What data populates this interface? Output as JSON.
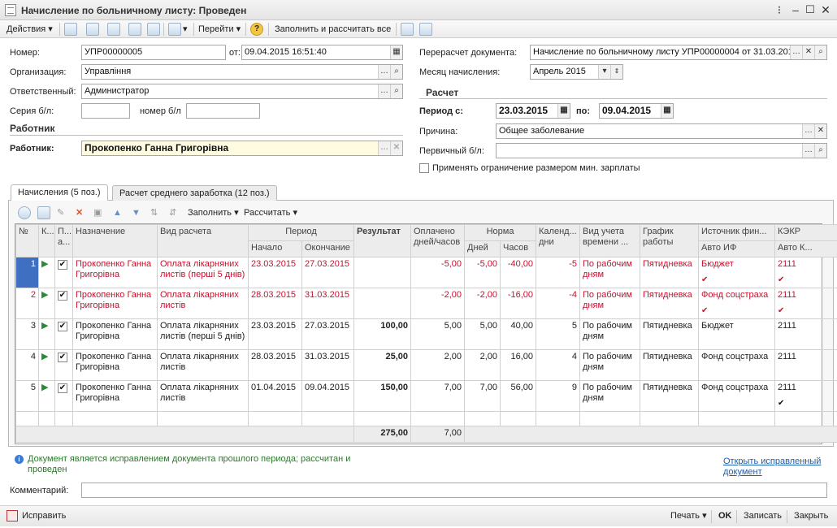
{
  "window": {
    "title": "Начисление по больничному листу: Проведен"
  },
  "toolbar": {
    "actions": "Действия",
    "goto": "Перейти",
    "fill_calc": "Заполнить и рассчитать все"
  },
  "form": {
    "number_label": "Номер:",
    "number": "УПР00000005",
    "date_label": "от:",
    "date": "09.04.2015 16:51:40",
    "org_label": "Организация:",
    "org": "Управління",
    "resp_label": "Ответственный:",
    "resp": "Администратор",
    "series_label": "Серия б/л:",
    "series": "",
    "num_bl_label": "номер б/л",
    "num_bl": "",
    "worker_section": "Работник",
    "worker_label": "Работник:",
    "worker": "Прокопенко Ганна Григорівна",
    "recalc_label": "Перерасчет документа:",
    "recalc": "Начисление по больничному листу УПР00000004 от 31.03.201",
    "month_label": "Месяц начисления:",
    "month": "Апрель 2015",
    "calc_section": "Расчет",
    "period_label": "Период с:",
    "period_from": "23.03.2015",
    "period_to_label": "по:",
    "period_to": "09.04.2015",
    "reason_label": "Причина:",
    "reason": "Общее заболевание",
    "primary_label": "Первичный б/л:",
    "primary": "",
    "minsalary_label": "Применять ограничение размером мин. зарплаты"
  },
  "tabs": [
    {
      "label": "Начисления (5 поз.)"
    },
    {
      "label": "Расчет среднего заработка (12 поз.)"
    }
  ],
  "grid_toolbar": {
    "fill": "Заполнить",
    "calc": "Рассчитать"
  },
  "grid": {
    "headers": {
      "n": "№",
      "k": "К...",
      "p": "П... а...",
      "name": "Назначение",
      "type": "Вид расчета",
      "period": "Период",
      "start": "Начало",
      "end": "Окончание",
      "result": "Результат",
      "paid": "Оплачено дней/часов",
      "norm": "Норма",
      "days": "Дней",
      "hours": "Часов",
      "cal": "Календ... дни",
      "acc": "Вид учета времени ...",
      "sched": "График работы",
      "src": "Источник фин...",
      "src2": "Авто ИФ",
      "kekr": "КЭКР",
      "kekr2": "Авто К..."
    },
    "rows": [
      {
        "n": "1",
        "name": "Прокопенко Ганна Григорівна",
        "type": "Оплата лікарняних листів (перші 5 днів)",
        "start": "23.03.2015",
        "end": "27.03.2015",
        "result": "",
        "paid": "-5,00",
        "days": "-5,00",
        "hours": "-40,00",
        "cal": "-5",
        "acc": "По рабочим дням",
        "sched": "Пятидневка",
        "src": "Бюджет",
        "kekr": "2111"
      },
      {
        "n": "2",
        "name": "Прокопенко Ганна Григорівна",
        "type": "Оплата лікарняних листів",
        "start": "28.03.2015",
        "end": "31.03.2015",
        "result": "",
        "paid": "-2,00",
        "days": "-2,00",
        "hours": "-16,00",
        "cal": "-4",
        "acc": "По рабочим дням",
        "sched": "Пятидневка",
        "src": "Фонд соцстраха",
        "kekr": "2111"
      },
      {
        "n": "3",
        "name": "Прокопенко Ганна Григорівна",
        "type": "Оплата лікарняних листів (перші 5 днів)",
        "start": "23.03.2015",
        "end": "27.03.2015",
        "result": "100,00",
        "paid": "5,00",
        "days": "5,00",
        "hours": "40,00",
        "cal": "5",
        "acc": "По рабочим дням",
        "sched": "Пятидневка",
        "src": "Бюджет",
        "kekr": "2111"
      },
      {
        "n": "4",
        "name": "Прокопенко Ганна Григорівна",
        "type": "Оплата лікарняних листів",
        "start": "28.03.2015",
        "end": "31.03.2015",
        "result": "25,00",
        "paid": "2,00",
        "days": "2,00",
        "hours": "16,00",
        "cal": "4",
        "acc": "По рабочим дням",
        "sched": "Пятидневка",
        "src": "Фонд соцстраха",
        "kekr": "2111"
      },
      {
        "n": "5",
        "name": "Прокопенко Ганна Григорівна",
        "type": "Оплата лікарняних листів",
        "start": "01.04.2015",
        "end": "09.04.2015",
        "result": "150,00",
        "paid": "7,00",
        "days": "7,00",
        "hours": "56,00",
        "cal": "9",
        "acc": "По рабочим дням",
        "sched": "Пятидневка",
        "src": "Фонд соцстраха",
        "kekr": "2111"
      }
    ],
    "totals": {
      "result": "275,00",
      "paid": "7,00"
    }
  },
  "info": {
    "text": "Документ является исправлением документа прошлого периода; рассчитан и проведен",
    "link": "Открыть исправленный документ"
  },
  "comment_label": "Комментарий:",
  "comment": "",
  "status": {
    "fix": "Исправить",
    "print": "Печать",
    "ok": "OK",
    "save": "Записать",
    "close": "Закрыть"
  },
  "colors": {
    "red": "#c8102e",
    "link": "#1a5fb4"
  }
}
